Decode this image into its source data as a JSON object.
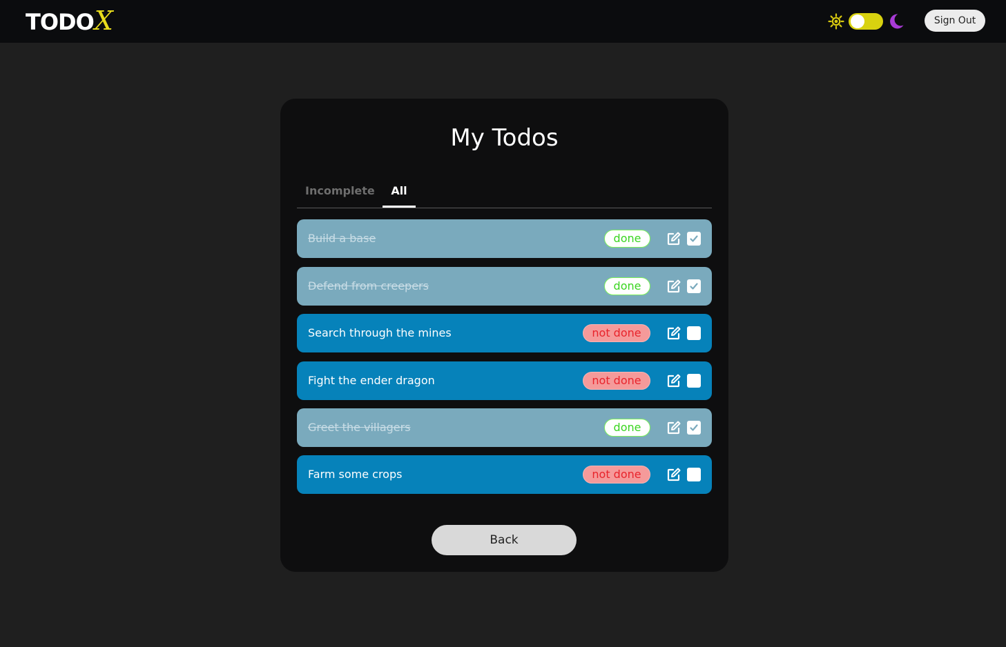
{
  "header": {
    "logo_text": "TODO",
    "logo_x": "X",
    "signout_label": "Sign Out",
    "theme": {
      "sun_icon": "sun-icon",
      "moon_icon": "moon-icon",
      "toggle_color": "#d8d20f"
    }
  },
  "main": {
    "title": "My Todos",
    "tabs": [
      {
        "label": "Incomplete",
        "active": false
      },
      {
        "label": "All",
        "active": true
      }
    ],
    "todos": [
      {
        "text": "Build a base",
        "status": "done",
        "checked": true
      },
      {
        "text": "Defend from creepers",
        "status": "done",
        "checked": true
      },
      {
        "text": "Search through the mines",
        "status": "not done",
        "checked": false
      },
      {
        "text": "Fight the ender dragon",
        "status": "not done",
        "checked": false
      },
      {
        "text": "Greet the villagers",
        "status": "done",
        "checked": true
      },
      {
        "text": "Farm some crops",
        "status": "not done",
        "checked": false
      }
    ],
    "back_label": "Back"
  },
  "colors": {
    "done_row": "#7aaabd",
    "open_row": "#0682ba",
    "done_badge_text": "#39d51f",
    "notdone_badge_text": "#e8232b",
    "accent_yellow": "#e8dc1c",
    "moon_purple": "#a83bd6"
  }
}
